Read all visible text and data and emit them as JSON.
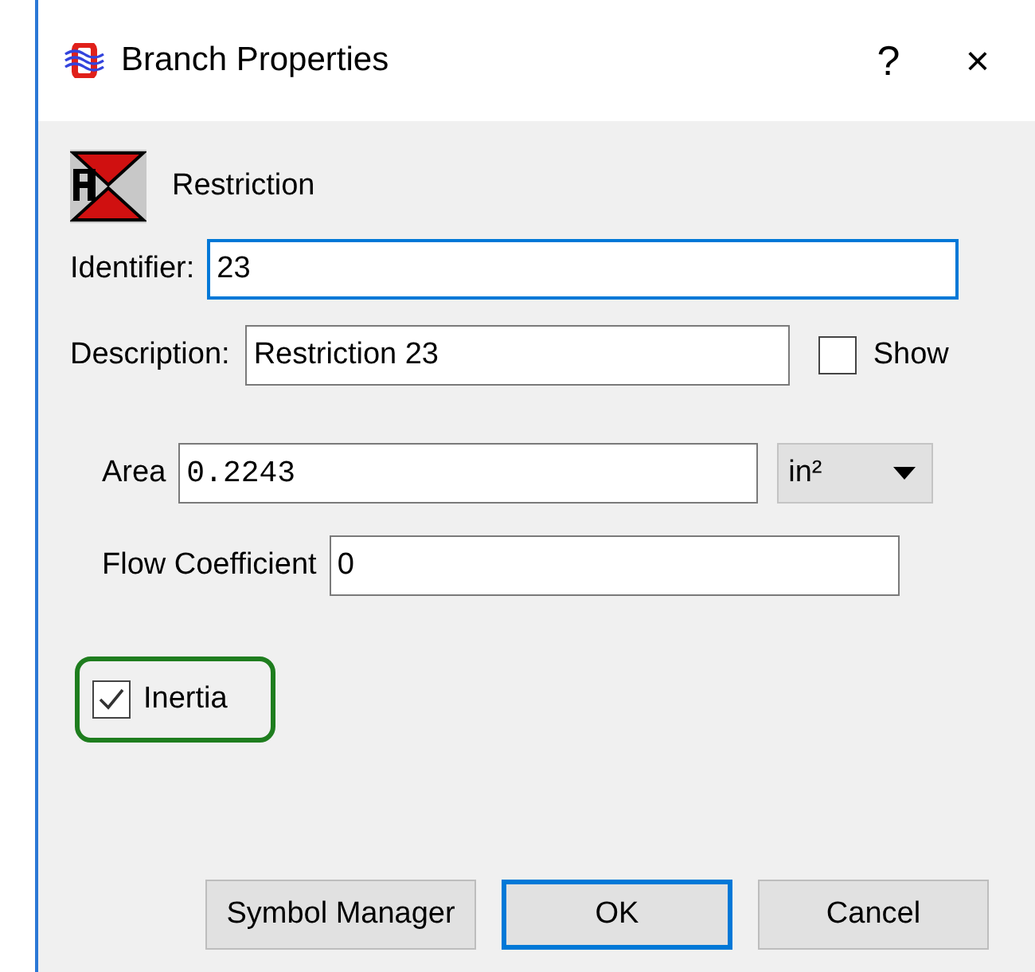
{
  "window": {
    "title": "Branch Properties",
    "help": "?",
    "close": "×"
  },
  "component": {
    "label": "Restriction"
  },
  "identifier": {
    "label": "Identifier:",
    "value": "23",
    "focused": true
  },
  "description": {
    "label": "Description:",
    "value": "Restriction 23"
  },
  "show": {
    "label": "Show",
    "checked": false
  },
  "area": {
    "label": "Area",
    "value": "0.2243",
    "unit": "in²"
  },
  "flow_coefficient": {
    "label": "Flow Coefficient",
    "value": "0"
  },
  "inertia": {
    "label": "Inertia",
    "checked": true,
    "highlighted": true
  },
  "buttons": [
    {
      "label": "Symbol Manager",
      "default": false
    },
    {
      "label": "OK",
      "default": true
    },
    {
      "label": "Cancel",
      "default": false
    }
  ]
}
